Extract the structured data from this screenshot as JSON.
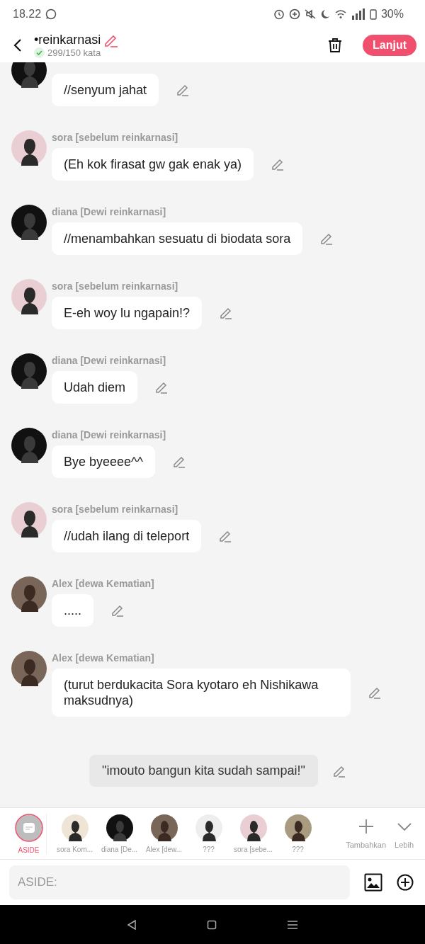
{
  "status_bar": {
    "time": "18.22",
    "battery": "30%"
  },
  "header": {
    "title": "•reinkarnasi",
    "word_count": "299/150 kata",
    "goal_met": true,
    "next_button": "Lanjut"
  },
  "messages": [
    {
      "kind": "chat",
      "color": "#111111",
      "text": "//senyum jahat"
    },
    {
      "kind": "chat",
      "color": "#e9cfd3",
      "speaker": "sora [sebelum reinkarnasi]",
      "text": "(Eh kok firasat gw gak enak ya)"
    },
    {
      "kind": "chat",
      "color": "#111111",
      "speaker": "diana [Dewi reinkarnasi]",
      "text": "//menambahkan sesuatu di biodata sora"
    },
    {
      "kind": "chat",
      "color": "#e9cfd3",
      "speaker": "sora [sebelum reinkarnasi]",
      "text": "E-eh woy lu ngapain!?"
    },
    {
      "kind": "chat",
      "color": "#111111",
      "speaker": "diana [Dewi reinkarnasi]",
      "text": "Udah diem"
    },
    {
      "kind": "chat",
      "color": "#111111",
      "speaker": "diana [Dewi reinkarnasi]",
      "text": "Bye byeeee^^"
    },
    {
      "kind": "chat",
      "color": "#e9cfd3",
      "speaker": "sora [sebelum reinkarnasi]",
      "text": "//udah ilang di teleport"
    },
    {
      "kind": "chat",
      "color": "#7a6658",
      "speaker": "Alex [dewa Kematian]",
      "text": "....."
    },
    {
      "kind": "chat",
      "color": "#7a6658",
      "speaker": "Alex [dewa Kematian]",
      "text": "(turut berdukacita Sora kyotaro eh Nishikawa maksudnya)"
    },
    {
      "kind": "aside",
      "text": "\"imouto bangun kita sudah sampai!\""
    }
  ],
  "characters": [
    {
      "kind": "aside",
      "name": "ASIDE",
      "selected": true
    },
    {
      "kind": "character",
      "color": "#efe5d6",
      "name": "sora Kom...",
      "selected": false
    },
    {
      "kind": "character",
      "color": "#111111",
      "name": "diana [De...",
      "selected": false
    },
    {
      "kind": "character",
      "color": "#7a6658",
      "name": "Alex [dew...",
      "selected": false
    },
    {
      "kind": "character",
      "color": "#eeeeee",
      "name": "???",
      "selected": false
    },
    {
      "kind": "character",
      "color": "#e9cfd3",
      "name": "sora [sebe...",
      "selected": false
    },
    {
      "kind": "character",
      "color": "#a89b80",
      "name": "???",
      "selected": false
    }
  ],
  "add_label": "Tambahkan",
  "more_label": "Lebih",
  "input": {
    "placeholder": "ASIDE:"
  }
}
